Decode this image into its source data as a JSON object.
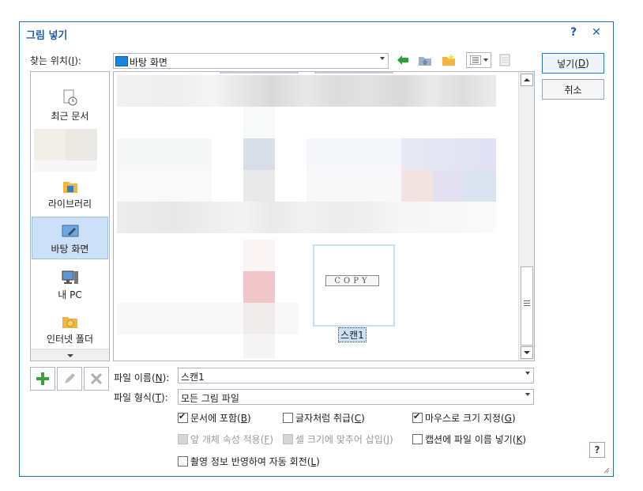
{
  "dialog": {
    "title": "그림 넣기",
    "help_glyph": "?",
    "close_glyph": "✕"
  },
  "location": {
    "label_pre": "찾는 위치(",
    "label_key": "I",
    "label_post": "):",
    "value": "바탕 화면"
  },
  "buttons": {
    "insert_pre": "넣기(",
    "insert_key": "D",
    "insert_post": ")",
    "cancel": "취소"
  },
  "places": [
    {
      "label": "최근 문서",
      "icon": "recent-documents-icon"
    },
    {
      "label": "라이브러리",
      "icon": "library-icon"
    },
    {
      "label": "바탕 화면",
      "icon": "desktop-icon",
      "selected": true
    },
    {
      "label": "내 PC",
      "icon": "this-pc-icon"
    },
    {
      "label": "인터넷 폴더",
      "icon": "internet-folder-icon"
    }
  ],
  "selected_file": {
    "name": "스캔1",
    "thumb_text": "COPY"
  },
  "filename": {
    "label_pre": "파일 이름(",
    "label_key": "N",
    "label_post": "):",
    "value": "스캔1"
  },
  "filetype": {
    "label_pre": "파일 형식(",
    "label_key": "T",
    "label_post": "):",
    "value": "모든 그림 파일"
  },
  "options": {
    "include_in_doc": {
      "pre": "문서에 포함(",
      "key": "B",
      "post": ")",
      "checked": true
    },
    "treat_as_char": {
      "pre": "글자처럼 취급(",
      "key": "C",
      "post": ")",
      "checked": false
    },
    "mouse_size": {
      "pre": "마우스로 크기 지정(",
      "key": "G",
      "post": ")",
      "checked": true
    },
    "apply_prev_attr": {
      "pre": "앞 개체 속성 적용(",
      "key": "F",
      "post": ")",
      "checked": false,
      "disabled": true
    },
    "fit_cell": {
      "pre": "셀 크기에 맞추어 삽입(",
      "key": "J",
      "post": ")",
      "checked": false,
      "disabled": true
    },
    "caption_filename": {
      "pre": "캡션에 파일 이름 넣기(",
      "key": "K",
      "post": ")",
      "checked": false
    },
    "auto_rotate": {
      "pre": "촬영 정보 반영하여 자동 회전(",
      "key": "L",
      "post": ")",
      "checked": false
    }
  },
  "help_button": "?",
  "colors": {
    "accent": "#1f5fae",
    "selection": "#cce0f7",
    "border": "#aeb6c4"
  }
}
